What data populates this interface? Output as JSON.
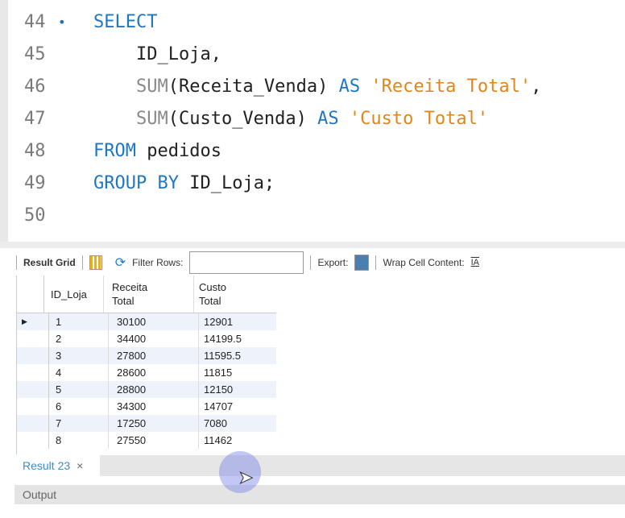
{
  "editor": {
    "lines": [
      {
        "n": "44",
        "marker": "•",
        "parts": [
          {
            "t": "SELECT",
            "c": "kw"
          }
        ]
      },
      {
        "n": "45",
        "parts": [
          {
            "t": "    ID_Loja,",
            "c": ""
          }
        ]
      },
      {
        "n": "46",
        "parts": [
          {
            "t": "    SUM",
            "c": "fn"
          },
          {
            "t": "(Receita_Venda) ",
            "c": ""
          },
          {
            "t": "AS ",
            "c": "kw"
          },
          {
            "t": "'Receita Total'",
            "c": "str"
          },
          {
            "t": ",",
            "c": ""
          }
        ]
      },
      {
        "n": "47",
        "parts": [
          {
            "t": "    SUM",
            "c": "fn"
          },
          {
            "t": "(Custo_Venda) ",
            "c": ""
          },
          {
            "t": "AS ",
            "c": "kw"
          },
          {
            "t": "'Custo Total'",
            "c": "str"
          }
        ]
      },
      {
        "n": "48",
        "parts": [
          {
            "t": "FROM ",
            "c": "kw"
          },
          {
            "t": "pedidos",
            "c": ""
          }
        ]
      },
      {
        "n": "49",
        "parts": [
          {
            "t": "GROUP BY ",
            "c": "kw"
          },
          {
            "t": "ID_Loja;",
            "c": ""
          }
        ]
      },
      {
        "n": "50",
        "parts": []
      }
    ]
  },
  "toolbar": {
    "result_grid": "Result Grid",
    "filter_rows": "Filter Rows:",
    "filter_value": "",
    "export": "Export:",
    "wrap": "Wrap Cell Content:"
  },
  "grid": {
    "headers": [
      "ID_Loja",
      "Receita\nTotal",
      "Custo\nTotal"
    ],
    "rows": [
      [
        "1",
        "30100",
        "12901"
      ],
      [
        "2",
        "34400",
        "14199.5"
      ],
      [
        "3",
        "27800",
        "11595.5"
      ],
      [
        "4",
        "28600",
        "11815"
      ],
      [
        "5",
        "28800",
        "12150"
      ],
      [
        "6",
        "34300",
        "14707"
      ],
      [
        "7",
        "17250",
        "7080"
      ],
      [
        "8",
        "27550",
        "11462"
      ]
    ]
  },
  "tabs": {
    "result": "Result 23",
    "close": "×"
  },
  "output": {
    "label": "Output"
  }
}
